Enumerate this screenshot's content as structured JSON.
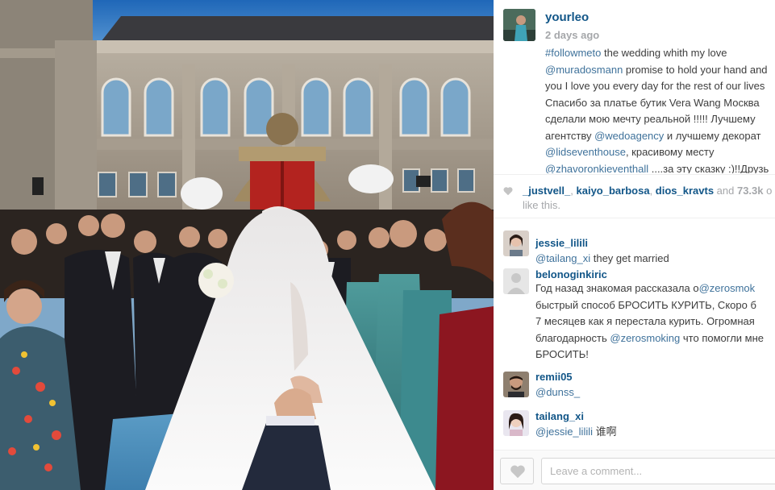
{
  "post": {
    "username": "yourleo",
    "time": "2 days ago",
    "caption": {
      "line1_hashtag": "#followmeto",
      "line1_text": " the wedding whith my love",
      "line2_mention": "@muradosmann",
      "line2_text": " promise to hold your hand and",
      "line3": "you I love you every day for the rest of our lives",
      "line4": "Спасибо за платье бутик Vera Wang Москва",
      "line5": "сделали мою мечту реальной !!!!! Лучшему",
      "line6_text": "агентству ",
      "line6_mention": "@wedoagency",
      "line6_tail": " и лучшему декорат",
      "line7_mention": "@lidseventhouse",
      "line7_tail": ", красивому месту",
      "line8_mention": "@zhavoronkieventhall",
      "line8_tail": " ....за эту сказку :)!!Друзь"
    }
  },
  "likes": {
    "user1": "_justvell_",
    "sep1": ", ",
    "user2": "kaiyo_barbosa",
    "sep2": ", ",
    "user3": "dios_kravts",
    "and": " and ",
    "count": "73.3k",
    "tail": " o",
    "line2": "like this."
  },
  "comments": [
    {
      "user": "jessie_lilili",
      "mention": "@tailang_xi",
      "text": " they get married"
    },
    {
      "user": "belonoginkiric",
      "line1_text": "Год назад знакомая рассказала о",
      "line1_mention": "@zerosmok",
      "line2": "быстрый способ БРОСИТЬ КУРИТЬ, Скоро б",
      "line3": "7 месяцев как я перестала курить. Огромная",
      "line4_text": "благодарность ",
      "line4_mention": "@zerosmoking",
      "line4_tail": " что помогли мне",
      "line5": "БРОСИТЬ!"
    },
    {
      "user": "remii05",
      "mention": "@dunss_"
    },
    {
      "user": "tailang_xi",
      "mention": "@jessie_lilili",
      "text": " 谁啊"
    }
  ],
  "footer": {
    "comment_placeholder": "Leave a comment..."
  },
  "icons": {
    "like": "heart-icon",
    "likes_summary": "heart-icon"
  },
  "colors": {
    "username": "#125688",
    "link": "#3f729b",
    "meta": "#a5a7aa",
    "text": "#3d3d3d"
  }
}
